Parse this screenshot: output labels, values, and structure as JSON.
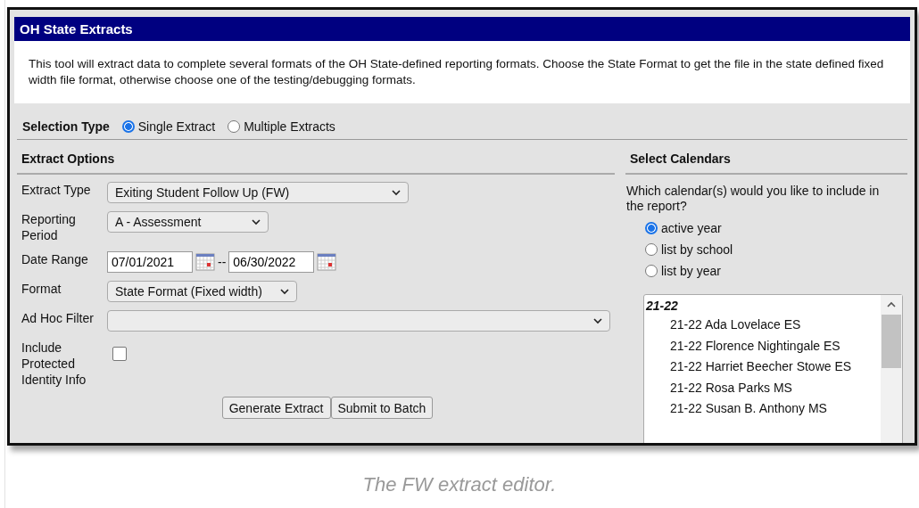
{
  "panel": {
    "title": "OH State Extracts",
    "description": "This tool will extract data to complete several formats of the OH State-defined reporting formats. Choose the State Format to get the file in the state defined fixed width file format, otherwise choose one of the testing/debugging formats."
  },
  "selection_type": {
    "label": "Selection Type",
    "options": [
      {
        "label": "Single Extract",
        "selected": true
      },
      {
        "label": "Multiple Extracts",
        "selected": false
      }
    ]
  },
  "extract_options": {
    "heading": "Extract Options",
    "fields": [
      {
        "kind": "select",
        "label": "Extract Type",
        "value": "Exiting Student Follow Up (FW)"
      },
      {
        "kind": "select",
        "label": "Reporting Period",
        "value": "A - Assessment"
      },
      {
        "kind": "daterange",
        "label": "Date Range",
        "start": "07/01/2021",
        "separator": "--",
        "end": "06/30/2022"
      },
      {
        "kind": "select",
        "label": "Format",
        "value": "State Format (Fixed width)"
      },
      {
        "kind": "select",
        "label": "Ad Hoc Filter"
      },
      {
        "kind": "checkbox",
        "label": "Include Protected Identity Info",
        "checked": false
      }
    ],
    "buttons": [
      "Generate Extract",
      "Submit to Batch"
    ]
  },
  "calendars": {
    "heading": "Select Calendars",
    "question": "Which calendar(s) would you like to include in the report?",
    "options": [
      {
        "label": "active year",
        "selected": true
      },
      {
        "label": "list by school",
        "selected": false
      },
      {
        "label": "list by year",
        "selected": false
      }
    ],
    "list": [
      {
        "label": "21-22",
        "children": [
          {
            "label": "21-22 Ada Lovelace ES"
          },
          {
            "label": "21-22 Florence Nightingale ES"
          },
          {
            "label": "21-22 Harriet Beecher Stowe ES"
          },
          {
            "label": "21-22 Rosa Parks MS"
          },
          {
            "label": "21-22 Susan B. Anthony MS"
          }
        ]
      }
    ]
  },
  "caption": "The FW extract editor."
}
